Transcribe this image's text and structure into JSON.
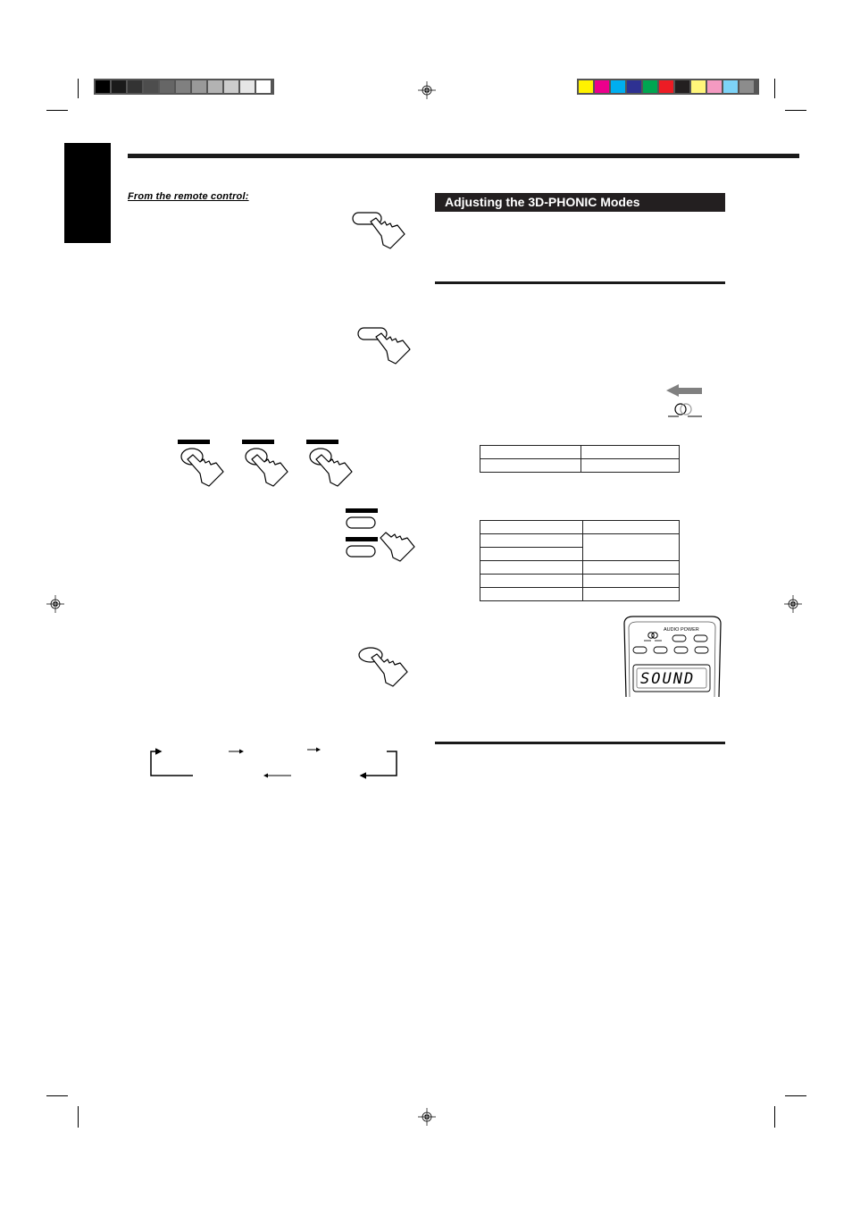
{
  "print_marks": {
    "grayscale_swatches": [
      "#000000",
      "#1a1a1a",
      "#333333",
      "#4d4d4d",
      "#666666",
      "#808080",
      "#999999",
      "#b3b3b3",
      "#cccccc",
      "#e6e6e6",
      "#ffffff"
    ],
    "color_swatches": [
      "#fff200",
      "#ec008c",
      "#00aeef",
      "#2e3192",
      "#00a651",
      "#ed1c24",
      "#231f20",
      "#fff57a",
      "#f49ac1",
      "#7dd3f7",
      "#8c8c8c"
    ]
  },
  "left_column": {
    "subheading": "From the remote control:"
  },
  "right_column": {
    "section_title": "Adjusting the 3D-PHONIC Modes",
    "remote_labels": {
      "audio_power": "AUDIO POWER",
      "lcd_text": "SOUND"
    }
  },
  "tables": {
    "table1": {
      "rows": [
        [
          "",
          ""
        ],
        [
          "",
          ""
        ]
      ]
    },
    "table2": {
      "rows": [
        [
          "",
          ""
        ],
        [
          "",
          ""
        ],
        [
          "",
          ""
        ],
        [
          "",
          ""
        ],
        [
          "",
          ""
        ],
        [
          "",
          ""
        ]
      ]
    }
  }
}
